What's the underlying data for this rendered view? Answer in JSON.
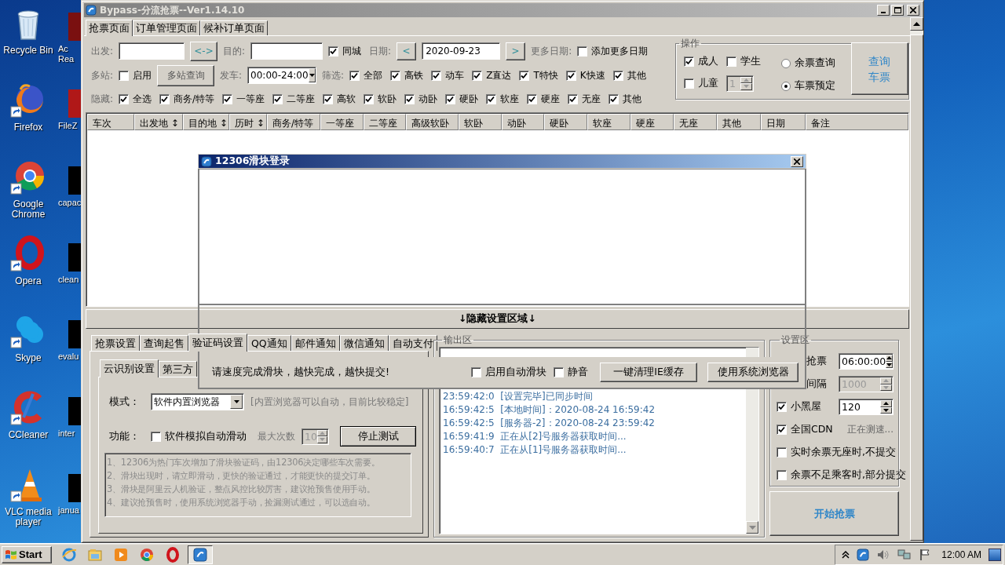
{
  "desktop": {
    "icons": [
      {
        "label": "Recycle Bin",
        "kind": "trash"
      },
      {
        "label": "Firefox",
        "kind": "globe"
      },
      {
        "label": "Google Chrome",
        "kind": "wheel"
      },
      {
        "label": "Opera",
        "kind": "ring"
      },
      {
        "label": "Skype",
        "kind": "cloud"
      },
      {
        "label": "CCleaner",
        "kind": "arc"
      },
      {
        "label": "VLC media player",
        "kind": "cone"
      }
    ],
    "partial_icons": [
      {
        "label": "Ac Rea",
        "color": "#7a1010"
      },
      {
        "label": "FileZ",
        "color": "#b01818"
      },
      {
        "label": "capac",
        "color": "#000000"
      },
      {
        "label": "clean",
        "color": "#000000"
      },
      {
        "label": "evalu",
        "color": "#000000"
      },
      {
        "label": "inter",
        "color": "#000000"
      },
      {
        "label": "janua",
        "color": "#000000"
      }
    ]
  },
  "window": {
    "title": "Bypass-分流抢票--Ver1.14.10"
  },
  "tabs": [
    {
      "label": "抢票页面",
      "selected": true
    },
    {
      "label": "订单管理页面",
      "selected": false
    },
    {
      "label": "候补订单页面",
      "selected": false
    }
  ],
  "route": {
    "from_label": "出发:",
    "swap_button": "<->",
    "to_label": "目的:",
    "same_city": {
      "label": "同城",
      "checked": true
    },
    "date_label": "日期:",
    "prev_button": "<",
    "date": "2020-09-23",
    "next_button": ">",
    "more_dates_label": "更多日期:",
    "add_more_dates": {
      "label": "添加更多日期",
      "checked": false
    }
  },
  "multi": {
    "label": "多站:",
    "enable": {
      "label": "启用",
      "checked": false
    },
    "button": "多站查询",
    "depart_label": "发车:",
    "depart_time": "00:00-24:00",
    "filter_label": "筛选:",
    "filters": [
      {
        "label": "全部",
        "checked": true
      },
      {
        "label": "高铁",
        "checked": true
      },
      {
        "label": "动车",
        "checked": true
      },
      {
        "label": "Z直达",
        "checked": true
      },
      {
        "label": "T特快",
        "checked": true
      },
      {
        "label": "K快速",
        "checked": true
      },
      {
        "label": "其他",
        "checked": true
      }
    ]
  },
  "hide": {
    "label": "隐藏:",
    "items": [
      {
        "label": "全选",
        "checked": true
      },
      {
        "label": "商务/特等",
        "checked": true
      },
      {
        "label": "一等座",
        "checked": true
      },
      {
        "label": "二等座",
        "checked": true
      },
      {
        "label": "高软",
        "checked": true
      },
      {
        "label": "软卧",
        "checked": true
      },
      {
        "label": "动卧",
        "checked": true
      },
      {
        "label": "硬卧",
        "checked": true
      },
      {
        "label": "软座",
        "checked": true
      },
      {
        "label": "硬座",
        "checked": true
      },
      {
        "label": "无座",
        "checked": true
      },
      {
        "label": "其他",
        "checked": true
      }
    ]
  },
  "operation": {
    "title": "操作",
    "passengers": [
      {
        "label": "成人",
        "checked": true
      },
      {
        "label": "学生",
        "checked": false
      },
      {
        "label": "儿童",
        "checked": false
      }
    ],
    "child_count": "1",
    "modes": [
      {
        "label": "余票查询",
        "selected": false
      },
      {
        "label": "车票预定",
        "selected": true
      }
    ],
    "query_button": "查询车票"
  },
  "table": {
    "columns": [
      "车次",
      "出发地 ↕",
      "目的地 ↕",
      "历时 ↕",
      "商务/特等",
      "一等座",
      "二等座",
      "高级软卧",
      "软卧",
      "动卧",
      "硬卧",
      "软座",
      "硬座",
      "无座",
      "其他",
      "日期",
      "备注"
    ]
  },
  "toggle_bar": "↓隐藏设置区域↓",
  "settings_tabs": [
    {
      "label": "抢票设置",
      "selected": false
    },
    {
      "label": "查询起售",
      "selected": false
    },
    {
      "label": "验证码设置",
      "selected": true
    },
    {
      "label": "QQ通知",
      "selected": false
    },
    {
      "label": "邮件通知",
      "selected": false
    },
    {
      "label": "微信通知",
      "selected": false
    },
    {
      "label": "自动支付",
      "selected": false
    }
  ],
  "captcha": {
    "subtabs": [
      {
        "label": "云识别设置",
        "selected": true
      },
      {
        "label": "第三方",
        "selected": false
      }
    ],
    "mode_label": "模式：",
    "mode_value": "软件内置浏览器",
    "mode_hint": "[内置浏览器可以自动，目前比较稳定]",
    "func_label": "功能：",
    "auto_slide": {
      "label": "软件模拟自动滑动",
      "checked": false
    },
    "max_label": "最大次数",
    "max_value": "10",
    "stop_button": "停止测试",
    "notes": [
      "1、12306为热门车次增加了滑块验证码，由12306决定哪些车次需要。",
      "2、滑块出现时，请立即滑动，更快的验证通过，才能更快的提交订单。",
      "3、滑块是阿里云人机验证，整点风控比较厉害，建议抢预售使用手动。",
      "4、建议抢预售时，使用系统浏览器手动，捡漏测试通过，可以选自动。"
    ]
  },
  "output": {
    "title": "输出区",
    "log": [
      "23:59:42:0  [设置完毕]已同步时间",
      "16:59:42:5  [本地时间]：2020-08-24 16:59:42",
      "16:59:42:5  [服务器-2]：2020-08-24 23:59:42",
      "16:59:41:9  正在从[2]号服务器获取时间...",
      "16:59:40:7  正在从[1]号服务器获取时间..."
    ]
  },
  "settings": {
    "title": "设置区",
    "rows": [
      {
        "kind": "spin",
        "label": "抢票",
        "value": "06:00:00",
        "disabled": false
      },
      {
        "kind": "spin",
        "label": "间隔",
        "value": "1000",
        "disabled": true
      },
      {
        "kind": "spin",
        "label": "小黑屋",
        "value": "120",
        "checked": true,
        "disabled": false
      },
      {
        "kind": "status",
        "label": "全国CDN",
        "checked": true,
        "status": "正在测速..."
      },
      {
        "kind": "check",
        "label": "实时余票无座时,不提交",
        "checked": false
      },
      {
        "kind": "check",
        "label": "余票不足乘客时,部分提交",
        "checked": false
      }
    ]
  },
  "start_button": "开始抢票",
  "dialog": {
    "title": "12306滑块登录",
    "message": "请速度完成滑块，越快完成，越快提交!",
    "options": [
      {
        "label": "启用自动滑块",
        "checked": false
      },
      {
        "label": "静音",
        "checked": false
      }
    ],
    "buttons": [
      "一键清理IE缓存",
      "使用系统浏览器"
    ]
  },
  "taskbar": {
    "start": "Start",
    "clock": "12:00 AM"
  }
}
